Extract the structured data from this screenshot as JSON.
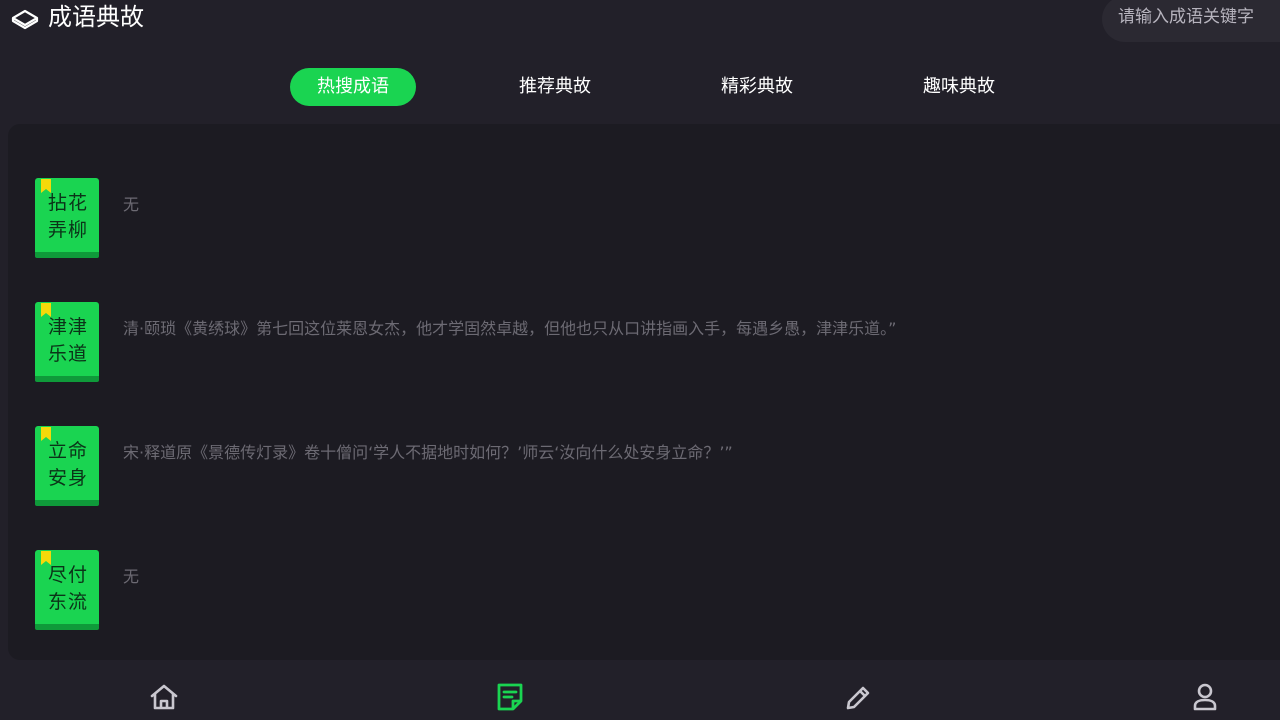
{
  "header": {
    "title": "成语典故",
    "logo_icon": "book-stack-icon",
    "search_placeholder": "请输入成语关键字"
  },
  "tabs": [
    {
      "label": "热搜成语",
      "active": true
    },
    {
      "label": "推荐典故",
      "active": false
    },
    {
      "label": "精彩典故",
      "active": false
    },
    {
      "label": "趣味典故",
      "active": false
    }
  ],
  "idioms": [
    {
      "title": "拈花弄柳",
      "source": "无"
    },
    {
      "title": "津津乐道",
      "source": "清·颐琐《黄绣球》第七回这位莱恩女杰，他才学固然卓越，但他也只从口讲指画入手，每遇乡愚，津津乐道。”"
    },
    {
      "title": "立命安身",
      "source": "宋·释道原《景德传灯录》卷十僧问‘学人不据地时如何？’师云‘汝向什么处安身立命？’”"
    },
    {
      "title": "尽付东流",
      "source": "无"
    }
  ],
  "bottom_nav": [
    {
      "icon": "home-icon",
      "active": false
    },
    {
      "icon": "document-icon",
      "active": true
    },
    {
      "icon": "pencil-icon",
      "active": false
    },
    {
      "icon": "user-icon",
      "active": false
    }
  ],
  "colors": {
    "accent": "#1ad451",
    "background": "#222029",
    "panel": "#1c1b22",
    "bookmark": "#f5d90a",
    "muted_text": "#6c6a73",
    "nav_icon": "#c9c7cf"
  }
}
